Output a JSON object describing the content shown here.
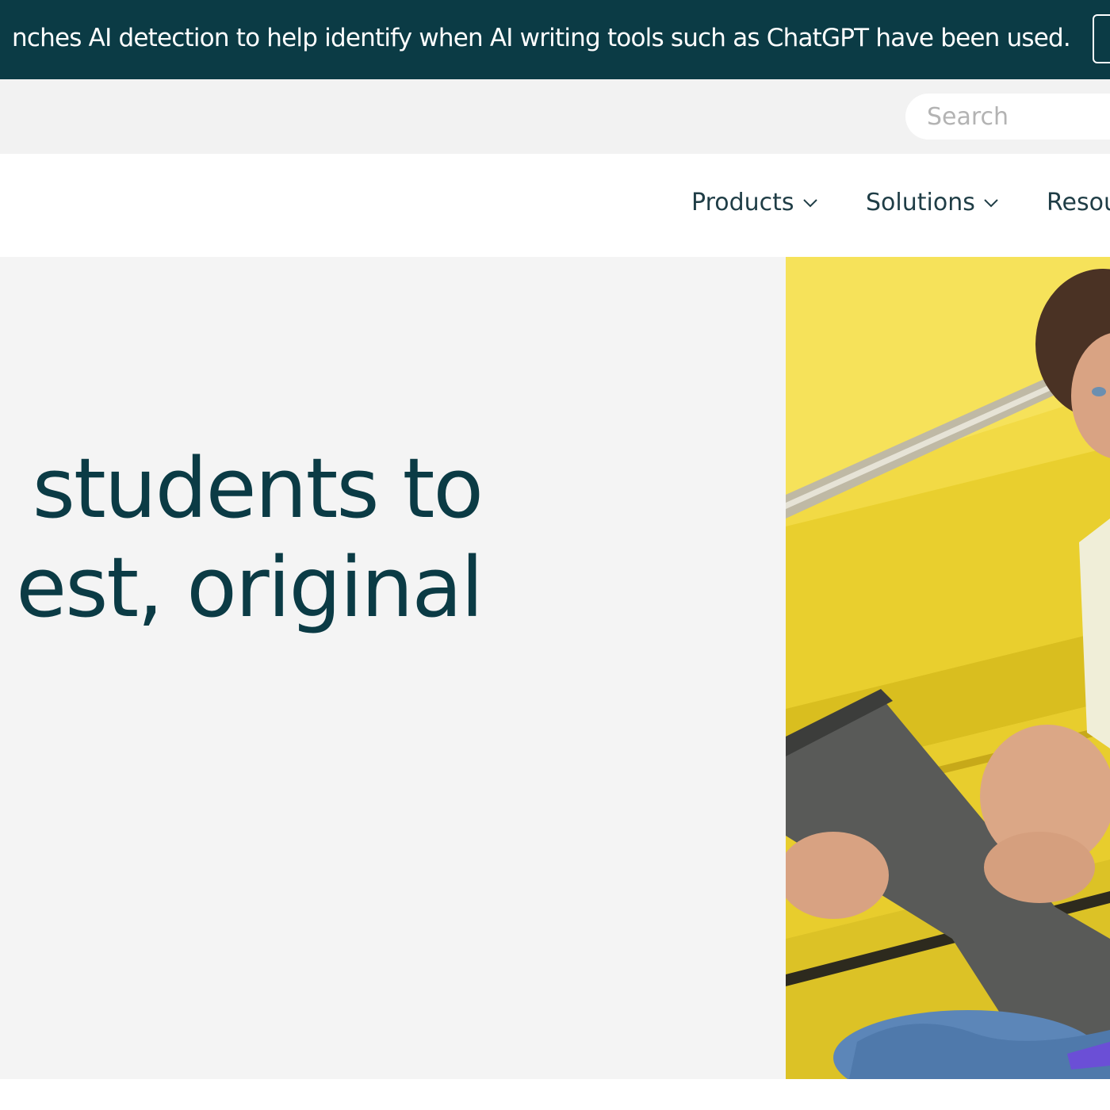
{
  "announcement": {
    "text": "nches AI detection to help identify when AI writing tools such as ChatGPT have been used."
  },
  "search": {
    "placeholder": "Search"
  },
  "nav": {
    "items": [
      {
        "label": "Products",
        "icon": "chevron-down-icon"
      },
      {
        "label": "Solutions",
        "icon": "chevron-down-icon"
      },
      {
        "label": "Resou"
      }
    ]
  },
  "hero": {
    "headline_line1": "students to",
    "headline_line2": "est, original",
    "image": "student-with-tablet-photo"
  },
  "colors": {
    "banner": "#0b3b45",
    "headline": "#0b3b45",
    "nav_text": "#1f3d46",
    "hero_bg": "#f4f4f4",
    "utility_bg": "#f2f2f2",
    "photo_wall": "#f1d83e"
  }
}
